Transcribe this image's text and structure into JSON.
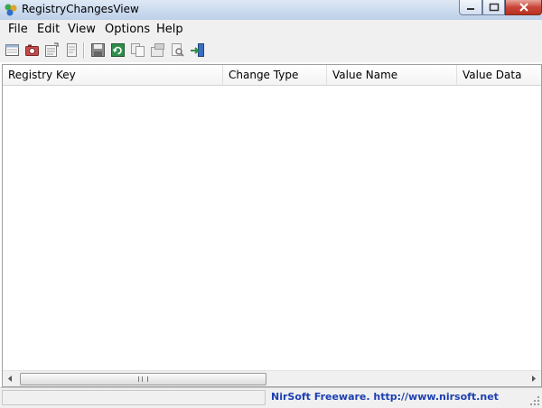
{
  "window": {
    "title": "RegistryChangesView"
  },
  "menu": {
    "items": [
      "File",
      "Edit",
      "View",
      "Options",
      "Help"
    ]
  },
  "toolbar": {
    "buttons": [
      "new-snapshot-icon",
      "camera-icon",
      "compare-icon",
      "properties-icon",
      "save-icon",
      "refresh-icon",
      "copy-icon",
      "export-icon",
      "find-icon",
      "exit-icon"
    ]
  },
  "table": {
    "columns": [
      "Registry Key",
      "Change Type",
      "Value Name",
      "Value Data"
    ],
    "rows": []
  },
  "statusbar": {
    "link_text": "NirSoft Freeware.  http://www.nirsoft.net"
  }
}
